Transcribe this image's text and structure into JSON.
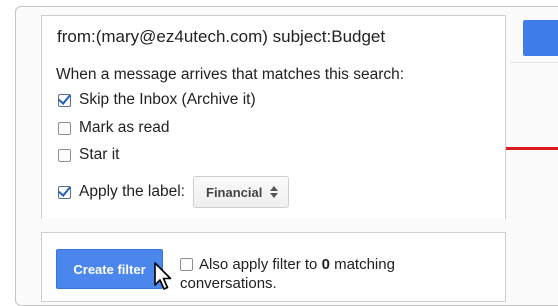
{
  "search": {
    "query": "from:(mary@ez4utech.com) subject:Budget"
  },
  "filter_options": {
    "intro": "When a message arrives that matches this search:",
    "skip_inbox": {
      "label": "Skip the Inbox (Archive it)",
      "checked": true
    },
    "mark_read": {
      "label": "Mark as read",
      "checked": false
    },
    "star_it": {
      "label": "Star it",
      "checked": false
    },
    "apply_label": {
      "label": "Apply the label:",
      "checked": true,
      "selected_label": "Financial"
    }
  },
  "footer": {
    "create_filter_label": "Create filter",
    "also_apply_prefix": "Also apply filter to ",
    "matching_count": "0",
    "also_apply_suffix": " matching",
    "also_apply_line2": "conversations.",
    "also_apply_checked": false
  },
  "colors": {
    "accent_blue": "#4a86ec",
    "checkmark_blue": "#1f5fbf",
    "annotation_red": "#dd1b1b"
  },
  "icons": [
    "checkbox-checked-icon",
    "checkbox-empty-icon",
    "select-updown-icon",
    "mouse-pointer-icon"
  ]
}
